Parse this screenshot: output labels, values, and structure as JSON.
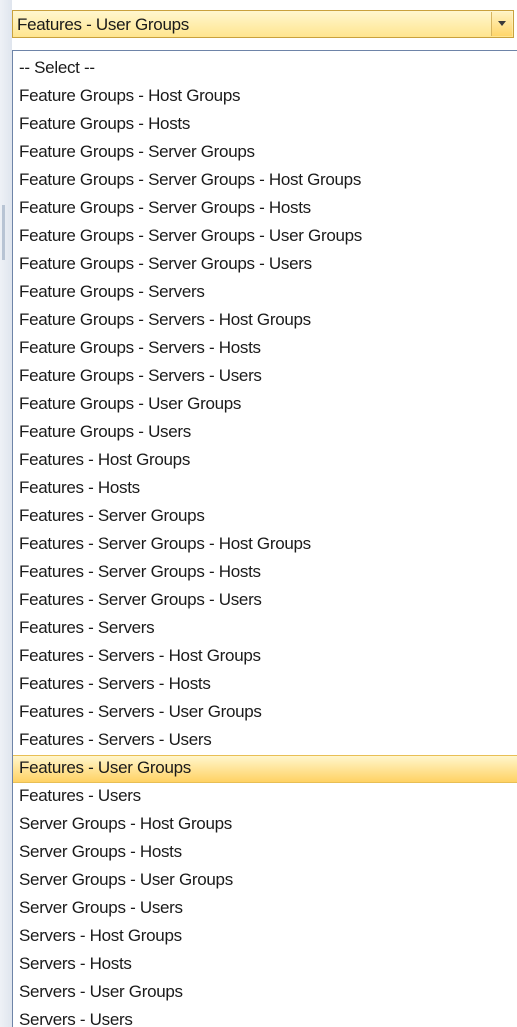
{
  "combo": {
    "selected_value": "Features - User Groups",
    "dropdown_icon": "chevron-down-icon"
  },
  "list": {
    "selected_index": 25,
    "items": [
      "-- Select --",
      "Feature Groups - Host Groups",
      "Feature Groups - Hosts",
      "Feature Groups - Server Groups",
      "Feature Groups - Server Groups - Host Groups",
      "Feature Groups - Server Groups - Hosts",
      "Feature Groups - Server Groups - User Groups",
      "Feature Groups - Server Groups - Users",
      "Feature Groups - Servers",
      "Feature Groups - Servers - Host Groups",
      "Feature Groups - Servers - Hosts",
      "Feature Groups - Servers - Users",
      "Feature Groups - User Groups",
      "Feature Groups - Users",
      "Features - Host Groups",
      "Features - Hosts",
      "Features - Server Groups",
      "Features - Server Groups - Host Groups",
      "Features - Server Groups - Hosts",
      "Features - Server Groups - Users",
      "Features - Servers",
      "Features - Servers - Host Groups",
      "Features - Servers - Hosts",
      "Features - Servers - User Groups",
      "Features - Servers - Users",
      "Features - User Groups",
      "Features - Users",
      "Server Groups - Host Groups",
      "Server Groups - Hosts",
      "Server Groups - User Groups",
      "Server Groups - Users",
      "Servers - Host Groups",
      "Servers - Hosts",
      "Servers - User Groups",
      "Servers - Users"
    ]
  },
  "colors": {
    "highlight": "#ffd264",
    "list_border": "#6e84a8"
  }
}
